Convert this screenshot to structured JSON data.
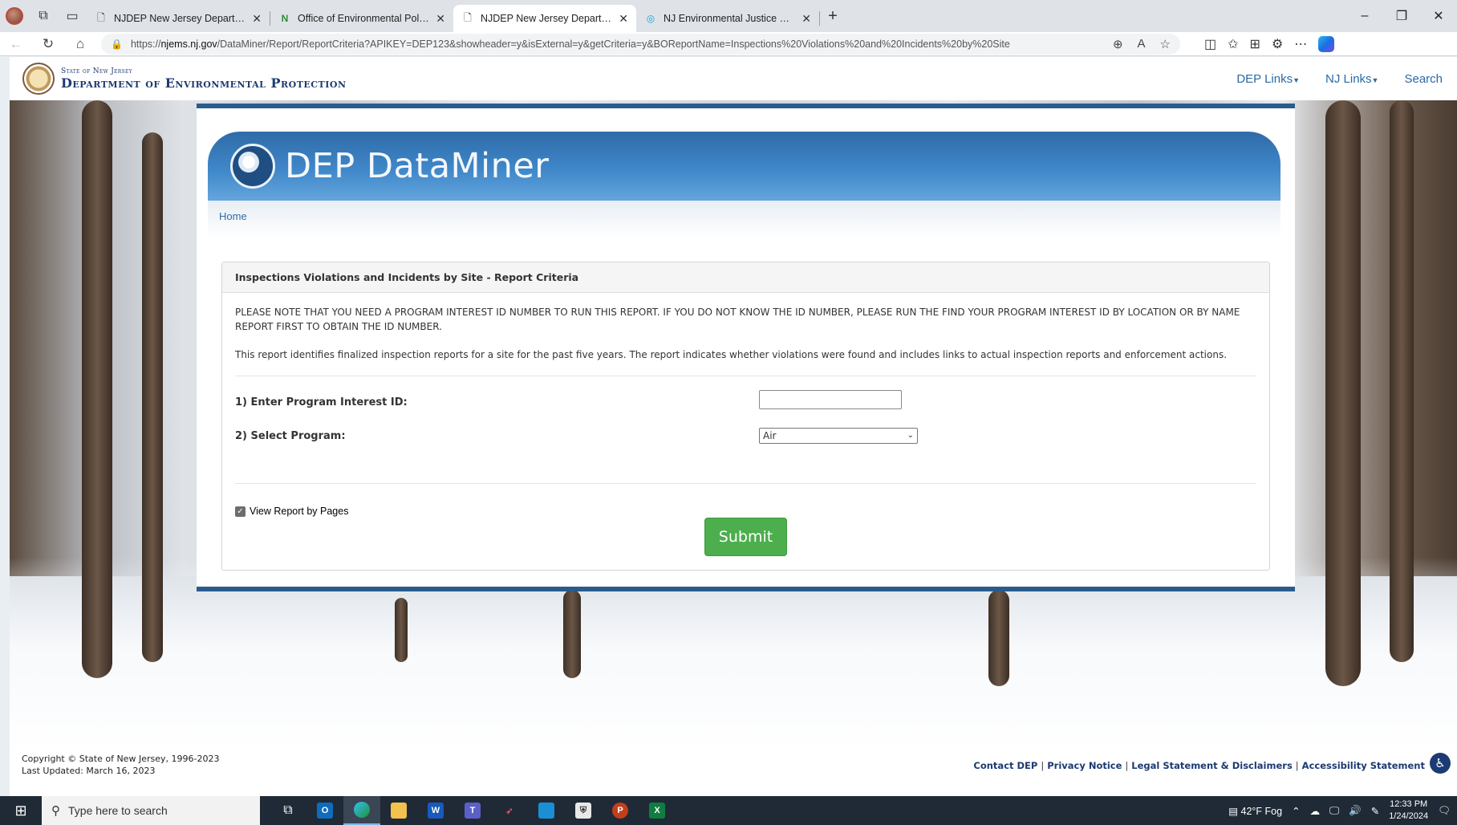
{
  "browser": {
    "tabs": [
      {
        "title": "NJDEP New Jersey Department o",
        "active": false
      },
      {
        "title": "Office of Environmental Policy",
        "active": false
      },
      {
        "title": "NJDEP New Jersey Department o",
        "active": true
      },
      {
        "title": "NJ Environmental Justice Mappin",
        "active": false
      }
    ],
    "url_prefix": "https://",
    "url_host": "njems.nj.gov",
    "url_path": "/DataMiner/Report/ReportCriteria?APIKEY=DEP123&showheader=y&isExternal=y&getCriteria=y&BOReportName=Inspections%20Violations%20and%20Incidents%20by%20Site"
  },
  "dep_header": {
    "state_line": "State of New Jersey",
    "dept_line": "Department of Environmental Protection",
    "nav": [
      "DEP Links",
      "NJ Links",
      "Search"
    ]
  },
  "dataminer": {
    "title": "DEP DataMiner",
    "breadcrumb": "Home"
  },
  "report": {
    "heading": "Inspections Violations and Incidents by Site - Report Criteria",
    "note": "PLEASE NOTE THAT YOU NEED A PROGRAM INTEREST ID NUMBER TO RUN THIS REPORT. IF YOU DO NOT KNOW THE ID NUMBER, PLEASE RUN THE FIND YOUR PROGRAM INTEREST ID BY LOCATION OR BY NAME REPORT FIRST TO OBTAIN THE ID NUMBER.",
    "description": "This report identifies finalized inspection reports for a site for the past five years. The report indicates whether violations were found and includes links to actual inspection reports and enforcement actions.",
    "field1_label": "1) Enter Program Interest ID:",
    "field1_value": "",
    "field2_label": "2) Select Program:",
    "field2_value": "Air",
    "checkbox_label": "View Report by Pages",
    "checkbox_checked": true,
    "submit_label": "Submit"
  },
  "footer": {
    "copyright": "Copyright © State of New Jersey, 1996-2023",
    "updated": "Last Updated: March 16, 2023",
    "links": [
      "Contact DEP",
      "Privacy Notice",
      "Legal Statement & Disclaimers",
      "Accessibility Statement"
    ]
  },
  "taskbar": {
    "search_placeholder": "Type here to search",
    "weather": "42°F  Fog",
    "time": "12:33 PM",
    "date": "1/24/2024"
  },
  "icons": {
    "accent": "#2a5b8f",
    "submit_color": "#4cae4c"
  }
}
